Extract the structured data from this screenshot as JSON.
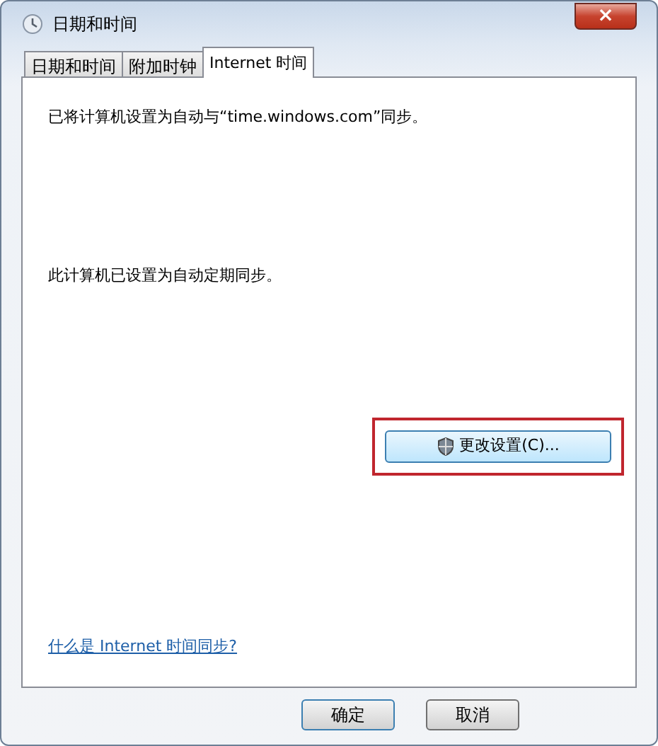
{
  "window": {
    "title": "日期和时间",
    "close": "×"
  },
  "tabs": [
    {
      "label": "日期和时间",
      "selected": false
    },
    {
      "label": "附加时钟",
      "selected": false
    },
    {
      "label": "Internet 时间",
      "selected": true
    }
  ],
  "panel": {
    "sync_info": "已将计算机设置为自动与“time.windows.com”同步。",
    "status": "此计算机已设置为自动定期同步。",
    "change_button": {
      "label": "更改设置(C)...",
      "highlighted": true
    },
    "help_link": "什么是 Internet 时间同步?"
  },
  "buttons": [
    {
      "label": "确定",
      "default": true
    },
    {
      "label": "取消",
      "default": false
    }
  ]
}
